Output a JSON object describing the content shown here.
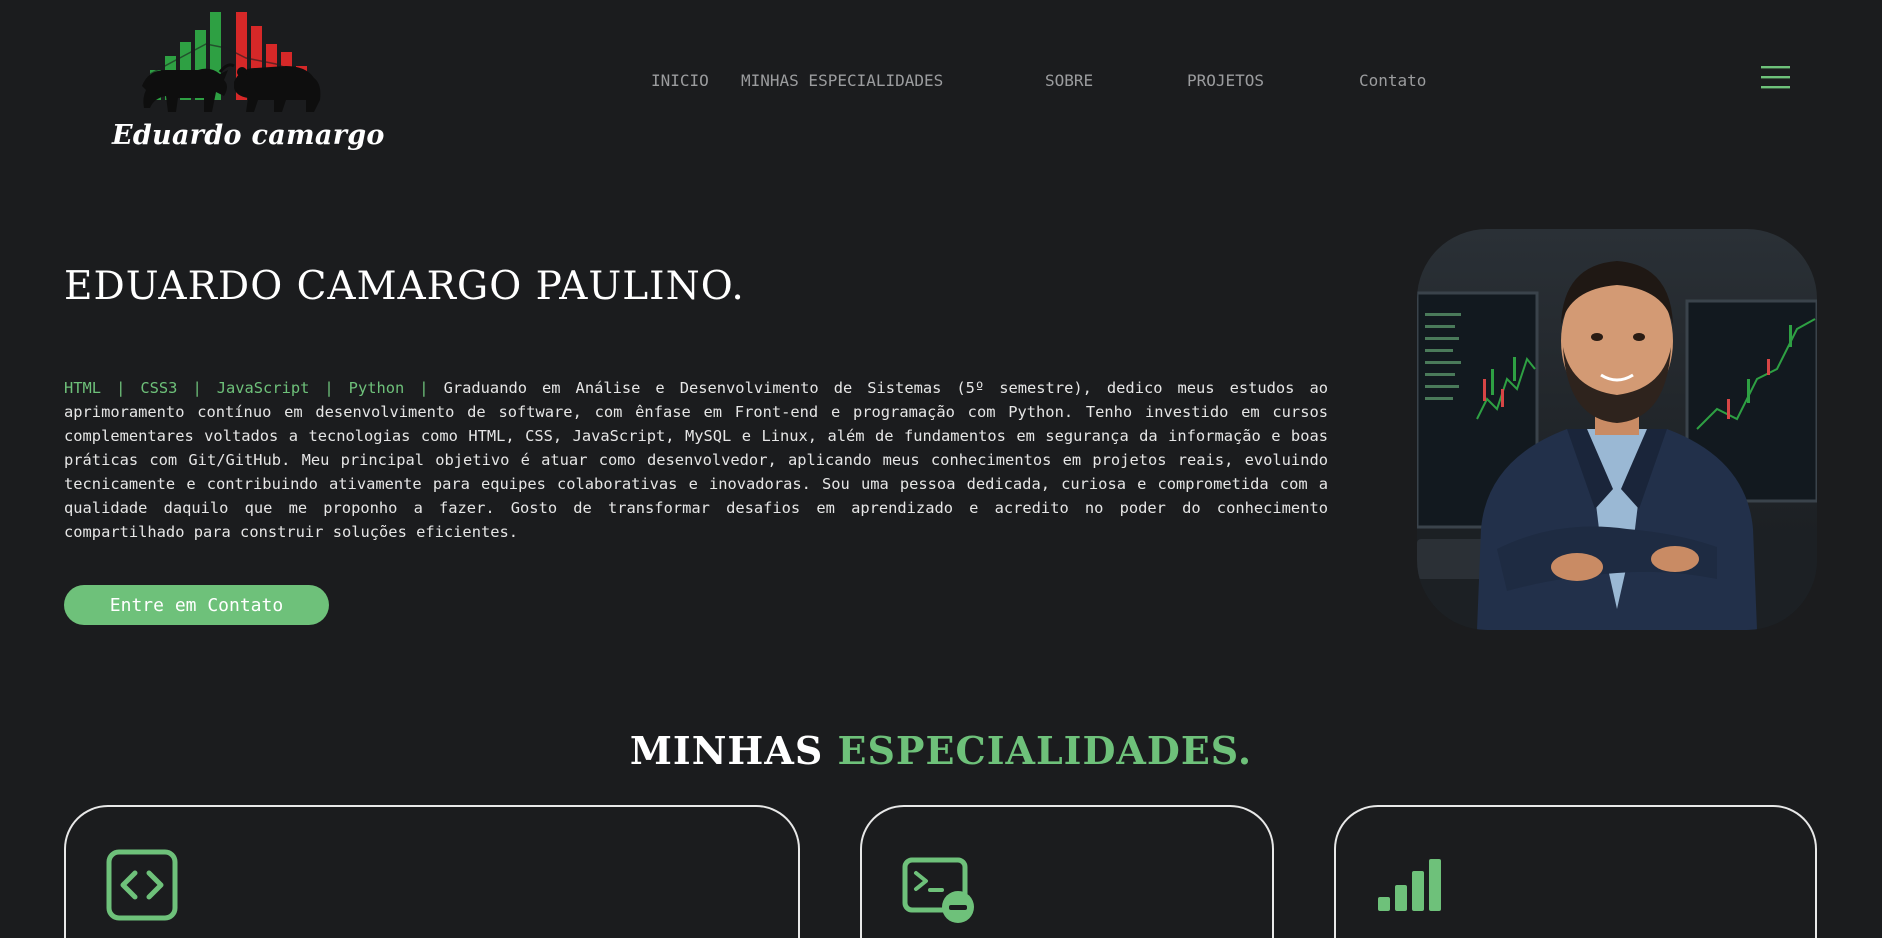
{
  "header": {
    "logo_text": "Eduardo camargo",
    "nav": [
      {
        "label": "INICIO"
      },
      {
        "label": "MINHAS ESPECIALIDADES"
      },
      {
        "label": "SOBRE"
      },
      {
        "label": "PROJETOS"
      },
      {
        "label": "Contato"
      }
    ],
    "menu_icon": "hamburger-menu-icon"
  },
  "hero": {
    "title": "EDUARDO CAMARGO PAULINO.",
    "skills": "HTML | CSS3 | JavaScript | Python |",
    "bio": "Graduando em Análise e Desenvolvimento de Sistemas (5º semestre), dedico meus estudos ao aprimoramento contínuo em desenvolvimento de software, com ênfase em Front-end e programação com Python. Tenho investido em cursos complementares voltados a tecnologias como HTML, CSS, JavaScript, MySQL e Linux, além de fundamentos em segurança da informação e boas práticas com Git/GitHub. Meu principal objetivo é atuar como desenvolvedor, aplicando meus conhecimentos em projetos reais, evoluindo tecnicamente e contribuindo ativamente para equipes colaborativas e inovadoras. Sou uma pessoa dedicada, curiosa e comprometida com a qualidade daquilo que me proponho a fazer. Gosto de transformar desafios em aprendizado e acredito no poder do conhecimento compartilhado para construir soluções eficientes.",
    "cta_label": "Entre em Contato"
  },
  "specialties": {
    "title_main": "MINHAS",
    "title_accent": "ESPECIALIDADES.",
    "cards": [
      {
        "icon": "code-brackets-icon"
      },
      {
        "icon": "terminal-icon"
      },
      {
        "icon": "bar-chart-icon"
      }
    ]
  },
  "colors": {
    "background": "#1b1c1e",
    "accent": "#6ec17a",
    "nav_text": "#9b9c9e",
    "bull_green": "#2ea043",
    "bear_red": "#d62828"
  }
}
